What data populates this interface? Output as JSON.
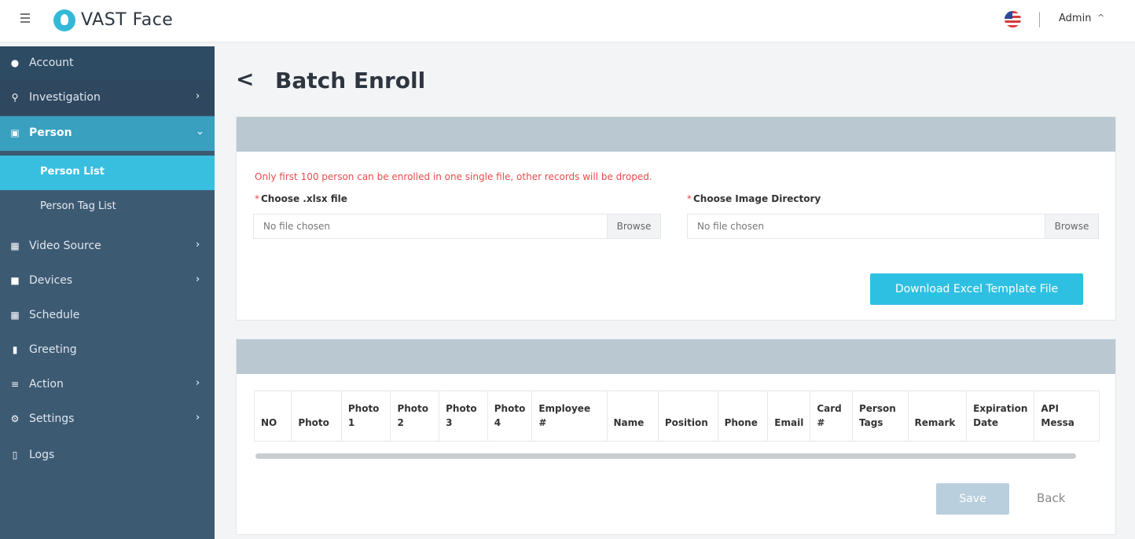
{
  "header": {
    "brand": "VAST Face",
    "user": "Admin"
  },
  "sidebar": {
    "items": [
      {
        "label": "Account",
        "icon": "users-icon"
      },
      {
        "label": "Investigation",
        "icon": "search-icon"
      },
      {
        "label": "Person",
        "icon": "person-card-icon"
      },
      {
        "label": "Video Source",
        "icon": "video-source-icon"
      },
      {
        "label": "Devices",
        "icon": "camera-icon"
      },
      {
        "label": "Schedule",
        "icon": "calendar-icon"
      },
      {
        "label": "Greeting",
        "icon": "comment-icon"
      },
      {
        "label": "Action",
        "icon": "list-icon"
      },
      {
        "label": "Settings",
        "icon": "gears-icon"
      },
      {
        "label": "Logs",
        "icon": "clipboard-icon"
      }
    ],
    "sub_items": [
      {
        "label": "Person List"
      },
      {
        "label": "Person Tag List"
      }
    ]
  },
  "page": {
    "title": "Batch Enroll"
  },
  "upload": {
    "notice": "Only first 100 person can be enrolled in one single file, other records will be droped.",
    "xlsx_label": "Choose .xlsx file",
    "dir_label": "Choose Image Directory",
    "required_mark": "*",
    "no_file": "No file chosen",
    "browse": "Browse",
    "download_button": "Download Excel Template File"
  },
  "table": {
    "columns": [
      "NO",
      "Photo",
      "Photo 1",
      "Photo 2",
      "Photo 3",
      "Photo 4",
      "Employee #",
      "Name",
      "Position",
      "Phone",
      "Email",
      "Card #",
      "Person Tags",
      "Remark",
      "Expiration Date",
      "API Messa"
    ]
  },
  "actions": {
    "save": "Save",
    "back": "Back"
  },
  "colors": {
    "sidebar_bg": "#3d5a73",
    "sidebar_active": "#38bfe0",
    "accent": "#2ec0e2",
    "warning_text": "#e84b4b",
    "panel_head": "#bac8d2"
  }
}
